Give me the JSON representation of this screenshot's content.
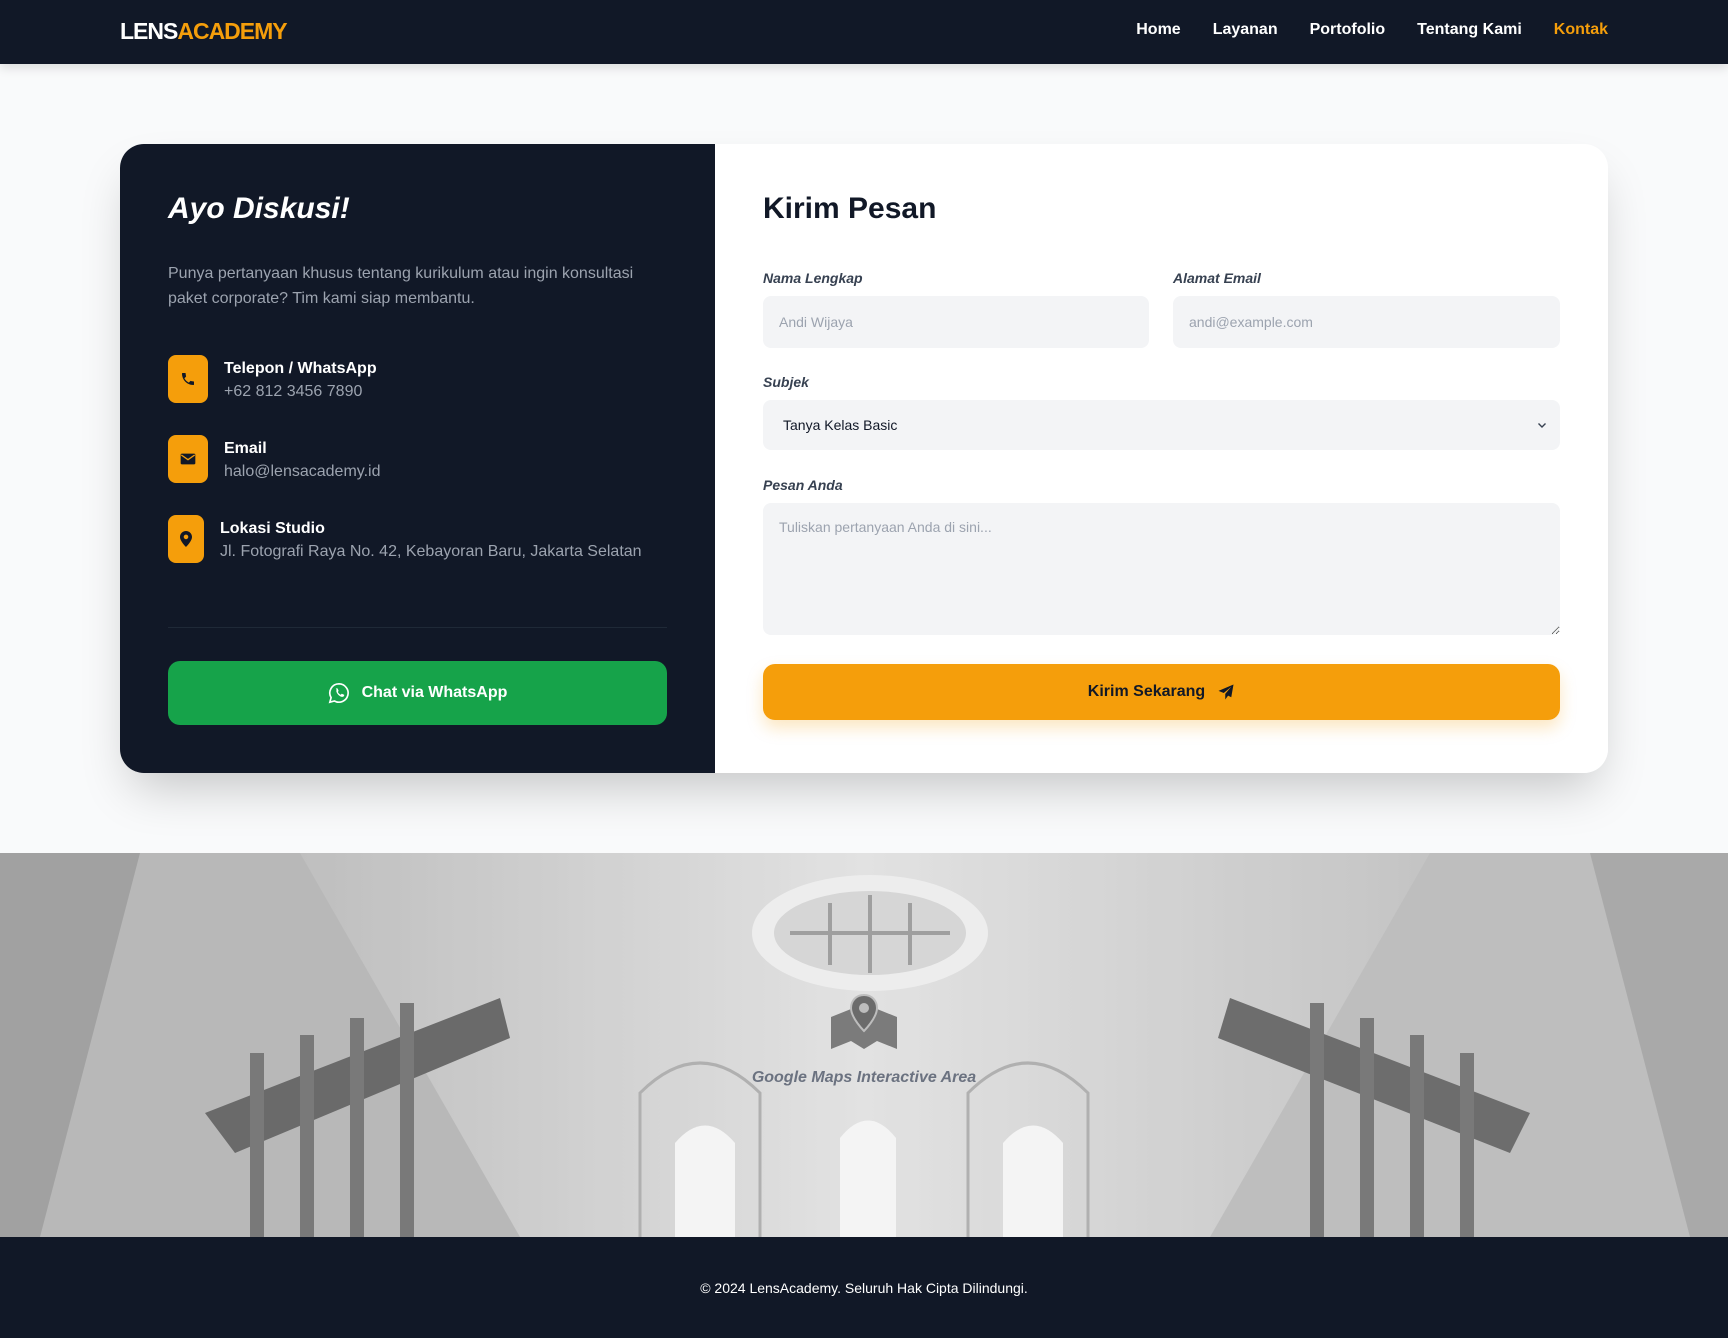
{
  "navbar": {
    "logo_part1": "LENS",
    "logo_part2": "ACADEMY",
    "links": [
      {
        "label": "Home",
        "active": false
      },
      {
        "label": "Layanan",
        "active": false
      },
      {
        "label": "Portofolio",
        "active": false
      },
      {
        "label": "Tentang Kami",
        "active": false
      },
      {
        "label": "Kontak",
        "active": true
      }
    ]
  },
  "contact": {
    "title": "Ayo Diskusi!",
    "description": "Punya pertanyaan khusus tentang kurikulum atau ingin konsultasi paket corporate? Tim kami siap membantu.",
    "items": [
      {
        "icon": "phone-icon",
        "label": "Telepon / WhatsApp",
        "value": "+62 812 3456 7890"
      },
      {
        "icon": "envelope-icon",
        "label": "Email",
        "value": "halo@lensacademy.id"
      },
      {
        "icon": "map-pin-icon",
        "label": "Lokasi Studio",
        "value": "Jl. Fotografi Raya No. 42, Kebayoran Baru, Jakarta Selatan"
      }
    ],
    "whatsapp_button": "Chat via WhatsApp"
  },
  "form": {
    "title": "Kirim Pesan",
    "name_label": "Nama Lengkap",
    "name_placeholder": "Andi Wijaya",
    "email_label": "Alamat Email",
    "email_placeholder": "andi@example.com",
    "subject_label": "Subjek",
    "subject_value": "Tanya Kelas Basic",
    "message_label": "Pesan Anda",
    "message_placeholder": "Tuliskan pertanyaan Anda di sini...",
    "submit_label": "Kirim Sekarang"
  },
  "map": {
    "icon": "map-icon",
    "label": "Google Maps Interactive Area"
  },
  "footer": {
    "copyright": "© 2024 LensAcademy. Seluruh Hak Cipta Dilindungi."
  },
  "colors": {
    "navy": "#111827",
    "accent": "#f59e0b",
    "whatsapp_green": "#16a34a",
    "input_bg": "#f3f4f6"
  }
}
